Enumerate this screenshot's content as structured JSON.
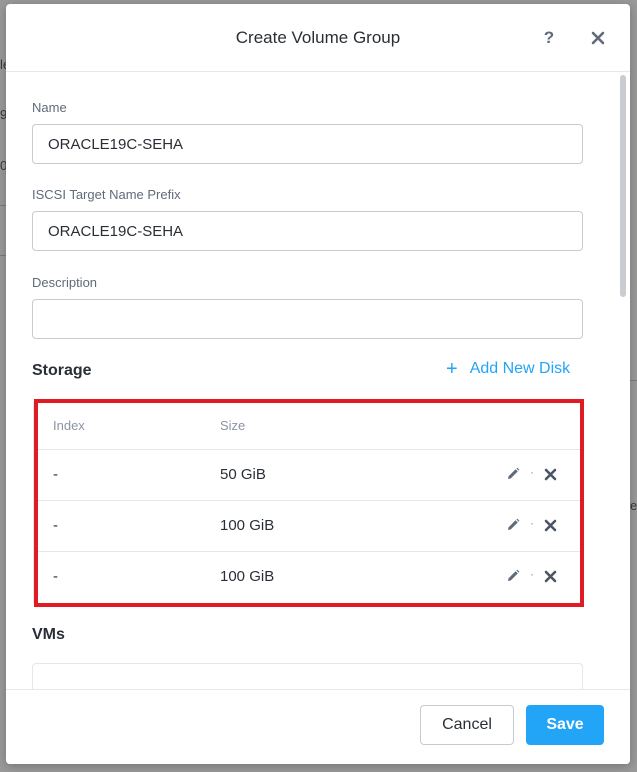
{
  "background": {
    "fragments": [
      "le",
      "9",
      "0",
      "e"
    ]
  },
  "modal": {
    "title": "Create Volume Group",
    "help_label": "?",
    "close_icon": "close-icon"
  },
  "form": {
    "name": {
      "label": "Name",
      "value": "ORACLE19C-SEHA"
    },
    "iscsi_prefix": {
      "label": "ISCSI Target Name Prefix",
      "value": "ORACLE19C-SEHA"
    },
    "description": {
      "label": "Description",
      "value": ""
    }
  },
  "storage": {
    "title": "Storage",
    "add_disk_label": "Add New Disk",
    "add_disk_icon": "+",
    "columns": [
      "Index",
      "Size"
    ],
    "rows": [
      {
        "index": "-",
        "size": "50 GiB"
      },
      {
        "index": "-",
        "size": "100 GiB"
      },
      {
        "index": "-",
        "size": "100 GiB"
      }
    ],
    "separator": "·"
  },
  "vms": {
    "title": "VMs"
  },
  "footer": {
    "cancel_label": "Cancel",
    "save_label": "Save"
  },
  "colors": {
    "accent": "#22a5f7",
    "highlight_border": "#e01b24",
    "text": "#2a2f36",
    "muted": "#5f6b7a"
  }
}
